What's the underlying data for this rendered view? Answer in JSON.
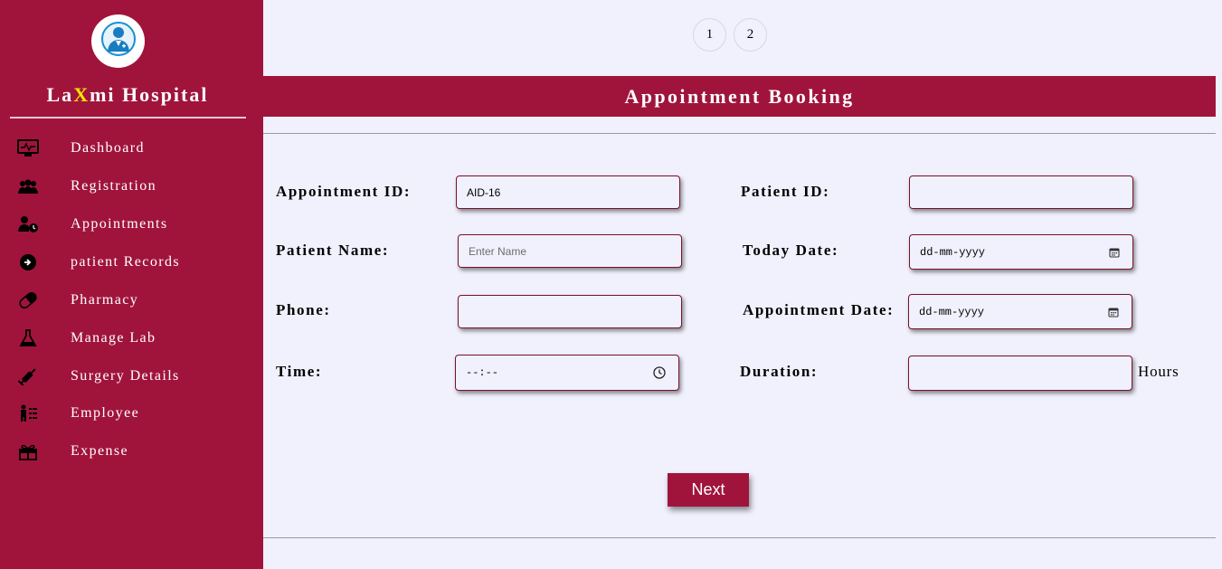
{
  "sidebar": {
    "brand_prefix": "La",
    "brand_highlight": "X",
    "brand_suffix": "mi Hospital",
    "logo_icon": "doctor-icon",
    "items": [
      {
        "label": "Dashboard",
        "icon": "monitor-icon"
      },
      {
        "label": "Registration",
        "icon": "users-icon"
      },
      {
        "label": "Appointments",
        "icon": "user-clock-icon"
      },
      {
        "label": "patient Records",
        "icon": "record-icon"
      },
      {
        "label": "Pharmacy",
        "icon": "pill-icon"
      },
      {
        "label": "Manage Lab",
        "icon": "flask-icon"
      },
      {
        "label": "Surgery Details",
        "icon": "syringe-icon"
      },
      {
        "label": "Employee",
        "icon": "employee-icon"
      },
      {
        "label": "Expense",
        "icon": "gift-icon"
      }
    ]
  },
  "pager": {
    "pages": [
      "1",
      "2"
    ]
  },
  "header": {
    "title": "Appointment Booking"
  },
  "form": {
    "appointment_id": {
      "label": "Appointment ID:",
      "value": "AID-16"
    },
    "patient_id": {
      "label": "Patient ID:",
      "value": ""
    },
    "patient_name": {
      "label": "Patient Name:",
      "placeholder": "Enter Name"
    },
    "today_date": {
      "label": "Today Date:",
      "value": "dd-mm-yyyy"
    },
    "phone": {
      "label": "Phone:",
      "value": ""
    },
    "appointment_date": {
      "label": "Appointment Date:",
      "value": "dd-mm-yyyy"
    },
    "time": {
      "label": "Time:",
      "value": "--:--"
    },
    "duration": {
      "label": "Duration:",
      "value": "",
      "unit": "Hours"
    }
  },
  "actions": {
    "next_label": "Next"
  },
  "colors": {
    "brand": "#a0143c",
    "background": "#f0f1fc",
    "highlight": "#f5e400"
  }
}
